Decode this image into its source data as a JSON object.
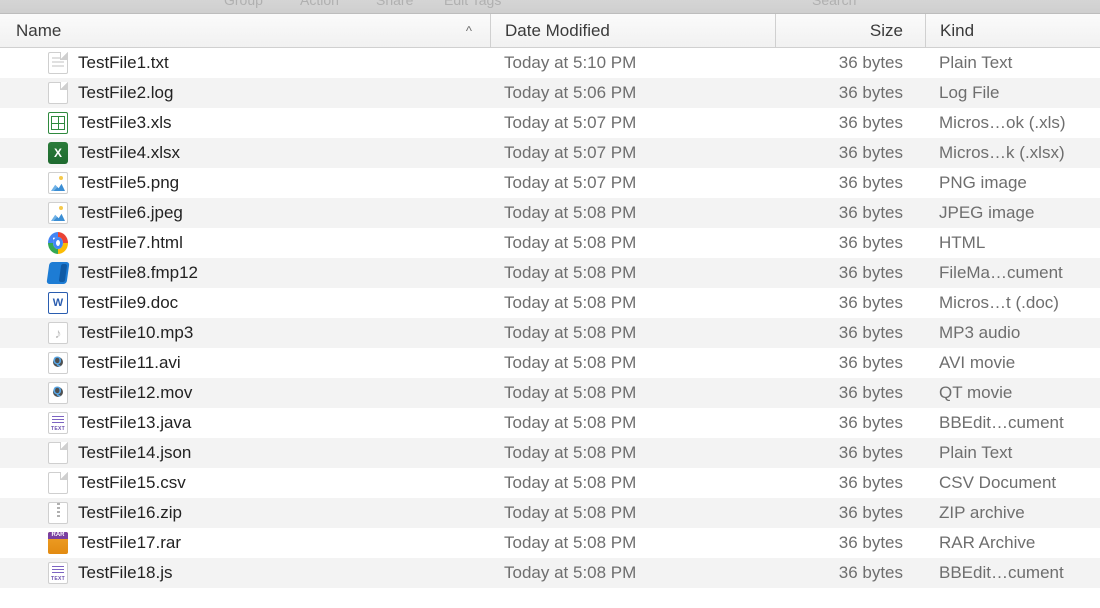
{
  "toolbar": {
    "group_label": "Group",
    "action_label": "Action",
    "share_label": "Share",
    "edit_tags_label": "Edit Tags",
    "search_label": "Search"
  },
  "columns": {
    "name": "Name",
    "date_modified": "Date Modified",
    "size": "Size",
    "kind": "Kind",
    "sort_indicator": "^"
  },
  "files": [
    {
      "name": "TestFile1.txt",
      "date": "Today at 5:10 PM",
      "size": "36 bytes",
      "kind": "Plain Text",
      "icon": "page txt"
    },
    {
      "name": "TestFile2.log",
      "date": "Today at 5:06 PM",
      "size": "36 bytes",
      "kind": "Log File",
      "icon": "log"
    },
    {
      "name": "TestFile3.xls",
      "date": "Today at 5:07 PM",
      "size": "36 bytes",
      "kind": "Micros…ok (.xls)",
      "icon": "xls"
    },
    {
      "name": "TestFile4.xlsx",
      "date": "Today at 5:07 PM",
      "size": "36 bytes",
      "kind": "Micros…k (.xlsx)",
      "icon": "xlsx"
    },
    {
      "name": "TestFile5.png",
      "date": "Today at 5:07 PM",
      "size": "36 bytes",
      "kind": "PNG image",
      "icon": "png"
    },
    {
      "name": "TestFile6.jpeg",
      "date": "Today at 5:08 PM",
      "size": "36 bytes",
      "kind": "JPEG image",
      "icon": "jpeg"
    },
    {
      "name": "TestFile7.html",
      "date": "Today at 5:08 PM",
      "size": "36 bytes",
      "kind": "HTML",
      "icon": "html"
    },
    {
      "name": "TestFile8.fmp12",
      "date": "Today at 5:08 PM",
      "size": "36 bytes",
      "kind": "FileMa…cument",
      "icon": "fmp"
    },
    {
      "name": "TestFile9.doc",
      "date": "Today at 5:08 PM",
      "size": "36 bytes",
      "kind": "Micros…t (.doc)",
      "icon": "doc"
    },
    {
      "name": "TestFile10.mp3",
      "date": "Today at 5:08 PM",
      "size": "36 bytes",
      "kind": "MP3 audio",
      "icon": "mp3"
    },
    {
      "name": "TestFile11.avi",
      "date": "Today at 5:08 PM",
      "size": "36 bytes",
      "kind": "AVI movie",
      "icon": "avi"
    },
    {
      "name": "TestFile12.mov",
      "date": "Today at 5:08 PM",
      "size": "36 bytes",
      "kind": "QT movie",
      "icon": "mov"
    },
    {
      "name": "TestFile13.java",
      "date": "Today at 5:08 PM",
      "size": "36 bytes",
      "kind": "BBEdit…cument",
      "icon": "java"
    },
    {
      "name": "TestFile14.json",
      "date": "Today at 5:08 PM",
      "size": "36 bytes",
      "kind": "Plain Text",
      "icon": "json"
    },
    {
      "name": "TestFile15.csv",
      "date": "Today at 5:08 PM",
      "size": "36 bytes",
      "kind": "CSV Document",
      "icon": "csv"
    },
    {
      "name": "TestFile16.zip",
      "date": "Today at 5:08 PM",
      "size": "36 bytes",
      "kind": "ZIP archive",
      "icon": "zip"
    },
    {
      "name": "TestFile17.rar",
      "date": "Today at 5:08 PM",
      "size": "36 bytes",
      "kind": "RAR Archive",
      "icon": "rar"
    },
    {
      "name": "TestFile18.js",
      "date": "Today at 5:08 PM",
      "size": "36 bytes",
      "kind": "BBEdit…cument",
      "icon": "js"
    }
  ]
}
